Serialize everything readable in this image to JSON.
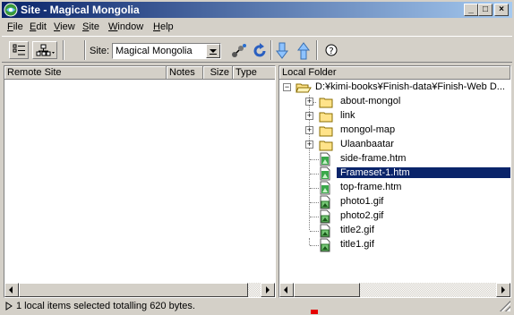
{
  "window": {
    "title": "Site - Magical Mongolia",
    "icon": "dreamweaver-site-icon",
    "controls": {
      "minimize": "_",
      "maximize": "□",
      "close": "×"
    }
  },
  "menu": [
    {
      "label": "File",
      "underline": "F",
      "rest": "ile"
    },
    {
      "label": "Edit",
      "underline": "E",
      "rest": "dit"
    },
    {
      "label": "View",
      "underline": "V",
      "rest": "iew"
    },
    {
      "label": "Site",
      "underline": "S",
      "rest": "ite"
    },
    {
      "label": "Window",
      "underline": "W",
      "rest": "indow"
    },
    {
      "label": "Help",
      "underline": "H",
      "rest": "elp"
    }
  ],
  "toolbar": {
    "site_label": "Site:",
    "site_value": "Magical Mongolia",
    "icons": [
      "site-files-icon",
      "site-map-icon",
      "connect-icon",
      "refresh-icon",
      "get-icon",
      "put-icon",
      "help-icon"
    ]
  },
  "remote": {
    "columns": [
      "Remote Site",
      "Notes",
      "Size",
      "Type"
    ]
  },
  "local": {
    "column": "Local Folder",
    "tree": [
      {
        "label": "D:¥kimi-books¥Finish-data¥Finish-Web D...",
        "type": "folder-open",
        "expander": "−"
      },
      {
        "label": "about-mongol",
        "type": "folder",
        "expander": "+"
      },
      {
        "label": "link",
        "type": "folder",
        "expander": "+"
      },
      {
        "label": "mongol-map",
        "type": "folder",
        "expander": "+"
      },
      {
        "label": "Ulaanbaatar",
        "type": "folder",
        "expander": "+"
      },
      {
        "label": "side-frame.htm",
        "type": "htm"
      },
      {
        "label": "Frameset-1.htm",
        "type": "htm",
        "selected": true
      },
      {
        "label": "top-frame.htm",
        "type": "htm"
      },
      {
        "label": "photo1.gif",
        "type": "gif"
      },
      {
        "label": "photo2.gif",
        "type": "gif"
      },
      {
        "label": "title2.gif",
        "type": "gif"
      },
      {
        "label": "title1.gif",
        "type": "gif"
      }
    ]
  },
  "status": {
    "text": "1 local items selected totalling 620 bytes."
  },
  "colors": {
    "title_start": "#0a246a",
    "title_end": "#a6caf0",
    "face": "#d4d0c8",
    "selection": "#0a246a"
  }
}
